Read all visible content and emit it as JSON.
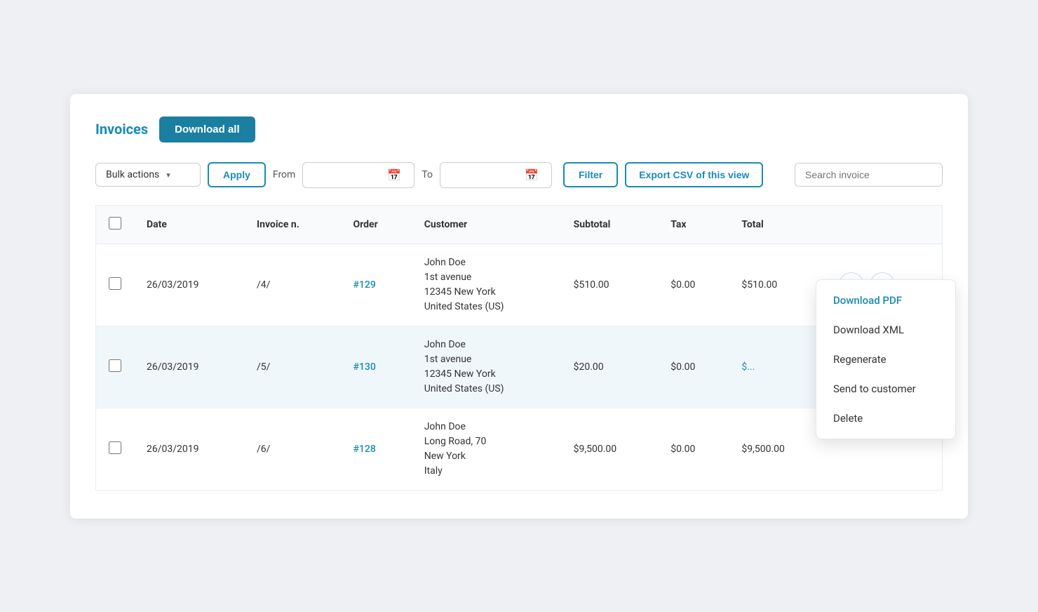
{
  "page": {
    "title": "Invoices",
    "download_all_label": "Download all"
  },
  "toolbar": {
    "bulk_actions_label": "Bulk actions",
    "apply_label": "Apply",
    "from_label": "From",
    "to_label": "To",
    "filter_label": "Filter",
    "export_csv_label": "Export CSV of this view",
    "search_placeholder": "Search invoice"
  },
  "table": {
    "headers": [
      "",
      "Date",
      "Invoice n.",
      "Order",
      "Customer",
      "Subtotal",
      "Tax",
      "Total",
      ""
    ],
    "rows": [
      {
        "id": "row1",
        "date": "26/03/2019",
        "invoice_n": "/4/",
        "order": "#129",
        "customer": "John Doe\n1st avenue\n12345 New York\nUnited States (US)",
        "subtotal": "$510.00",
        "tax": "$0.00",
        "total": "$510.00",
        "has_dropdown": true
      },
      {
        "id": "row2",
        "date": "26/03/2019",
        "invoice_n": "/5/",
        "order": "#130",
        "customer": "John Doe\n1st avenue\n12345 New York\nUnited States (US)",
        "subtotal": "$20.00",
        "tax": "$0.00",
        "total": "$...",
        "has_dropdown": false
      },
      {
        "id": "row3",
        "date": "26/03/2019",
        "invoice_n": "/6/",
        "order": "#128",
        "customer": "John Doe\nLong Road, 70\nNew York\nItaly",
        "subtotal": "$9,500.00",
        "tax": "$0.00",
        "total": "$9,500.00",
        "has_dropdown": false
      }
    ]
  },
  "dropdown": {
    "items": [
      "Download PDF",
      "Download XML",
      "Regenerate",
      "Send to customer",
      "Delete"
    ]
  }
}
